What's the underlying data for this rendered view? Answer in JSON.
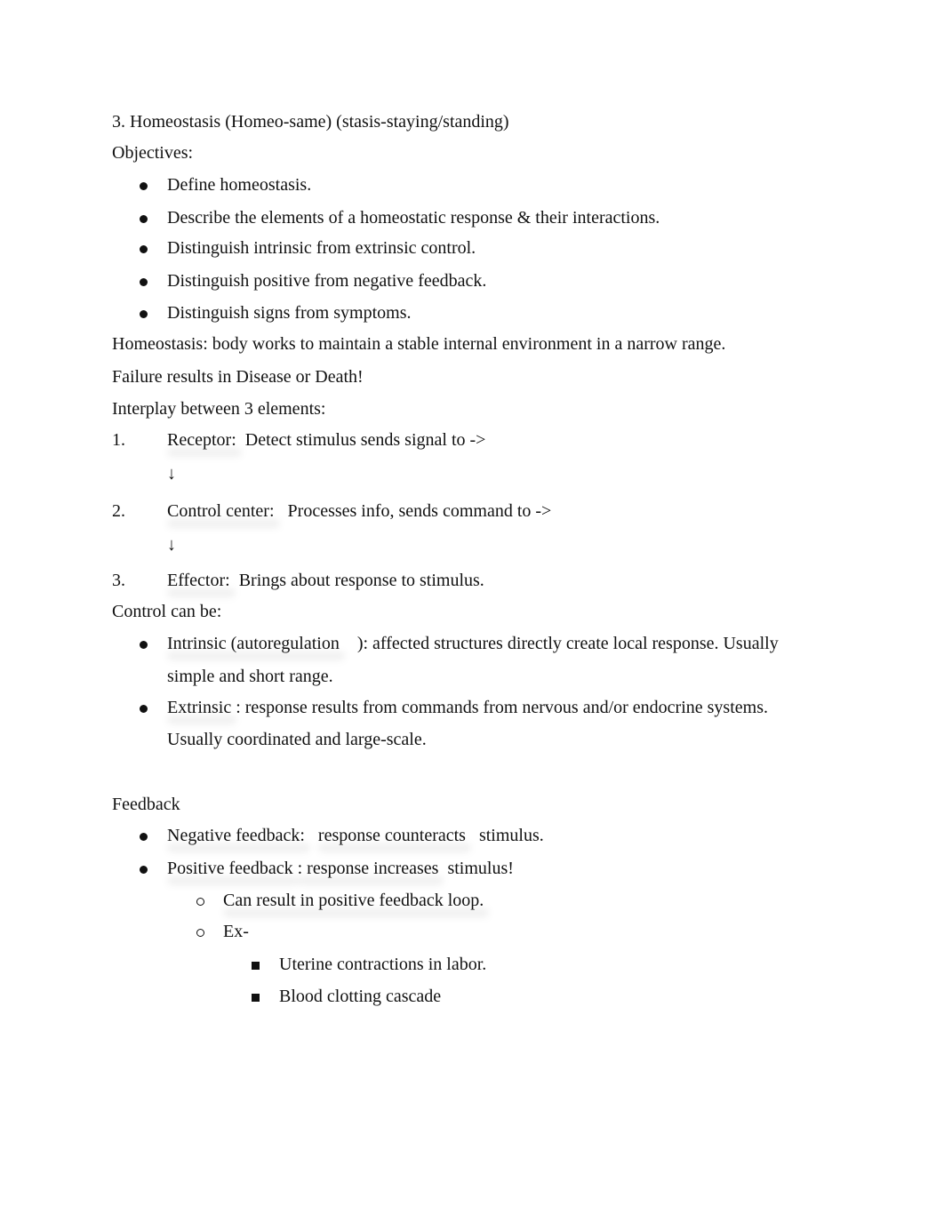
{
  "title": "3. Homeostasis (Homeo-same) (stasis-staying/standing)",
  "objectives_label": "Objectives:",
  "objectives": [
    "Define homeostasis.",
    "Describe the elements of a homeostatic response & their interactions.",
    "Distinguish intrinsic from extrinsic control.",
    "Distinguish positive from negative feedback.",
    "Distinguish signs from symptoms."
  ],
  "definition": "Homeostasis: body works to maintain a stable internal environment in a narrow range.",
  "failure": "Failure results in Disease or Death!",
  "interplay_label": "Interplay between 3 elements:",
  "elements": [
    {
      "num": "1.",
      "term": "Receptor:",
      "desc": "Detect stimulus sends signal to ->"
    },
    {
      "num": "2.",
      "term": "Control center:",
      "desc": "Processes info, sends command to ->"
    },
    {
      "num": "3.",
      "term": "Effector:",
      "desc": "Brings about response to stimulus."
    }
  ],
  "arrow": "↓",
  "control_label": "Control can be:",
  "control": [
    {
      "term": "Intrinsic (autoregulation",
      "rest": "): affected structures directly create local response. Usually",
      "cont": "simple and short range."
    },
    {
      "term": "Extrinsic",
      "rest": " : response results from commands from nervous and/or endocrine systems.",
      "cont": "Usually coordinated and large-scale."
    }
  ],
  "feedback_label": "Feedback",
  "feedback": [
    {
      "term": "Negative feedback:",
      "mid": "response counteracts",
      "end": "stimulus."
    },
    {
      "term": "Positive feedback",
      "mid": ": response increases",
      "end": "stimulus!"
    }
  ],
  "sub_items": [
    "Can result in positive feedback loop.",
    "Ex-"
  ],
  "examples": [
    "Uterine contractions in labor.",
    "Blood clotting cascade"
  ]
}
